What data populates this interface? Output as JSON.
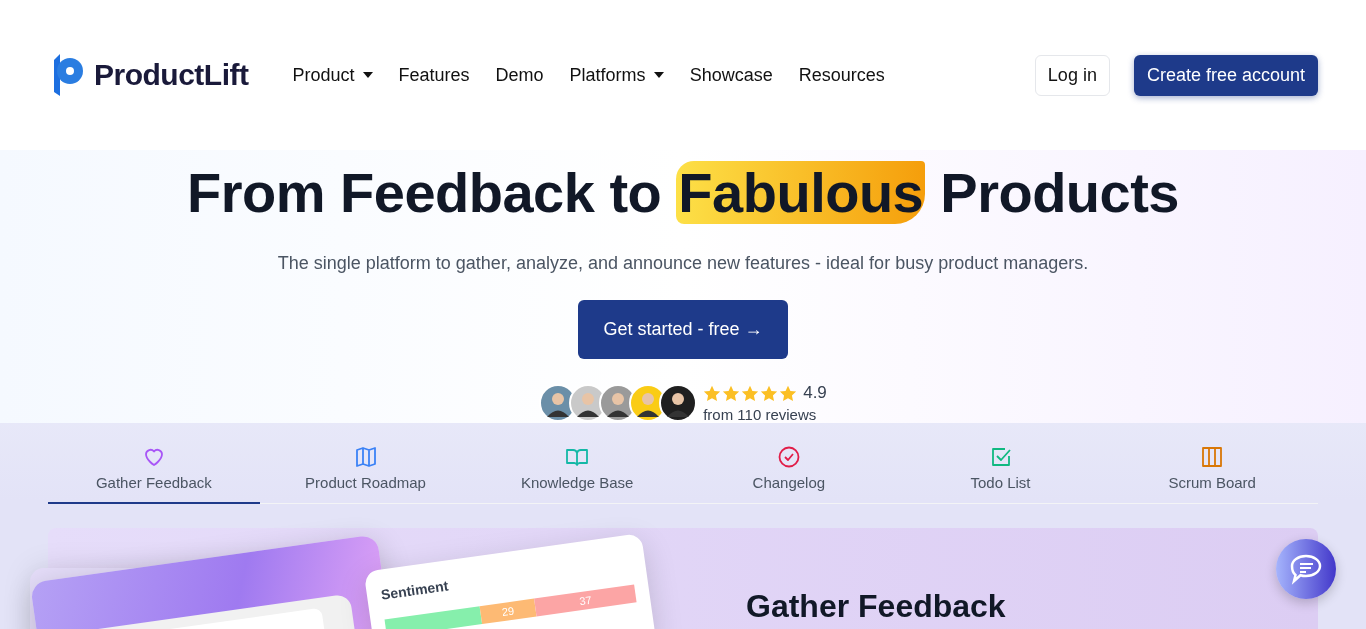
{
  "brand": {
    "name": "ProductLift"
  },
  "nav": [
    {
      "label": "Product",
      "dropdown": true
    },
    {
      "label": "Features",
      "dropdown": false
    },
    {
      "label": "Demo",
      "dropdown": false
    },
    {
      "label": "Platforms",
      "dropdown": true
    },
    {
      "label": "Showcase",
      "dropdown": false
    },
    {
      "label": "Resources",
      "dropdown": false
    }
  ],
  "login": "Log in",
  "signup": "Create free account",
  "hero": {
    "before": "From Feedback to ",
    "highlight": "Fabulous",
    "after": " Products",
    "subtitle": "The single platform to gather, analyze, and announce new features - ideal for busy product managers.",
    "cta": "Get started - free →"
  },
  "reviews": {
    "stars": 5,
    "score": "4.9",
    "count": "from 110 reviews"
  },
  "tabs": [
    {
      "label": "Gather Feedback",
      "selected": true
    },
    {
      "label": "Product Roadmap",
      "selected": false
    },
    {
      "label": "Knowledge Base",
      "selected": false
    },
    {
      "label": "Changelog",
      "selected": false
    },
    {
      "label": "Todo List",
      "selected": false
    },
    {
      "label": "Scrum Board",
      "selected": false
    }
  ],
  "panel": {
    "title": "Gather Feedback",
    "sentiment": {
      "title": "Sentiment",
      "segments": [
        {
          "color": "#86efac"
        },
        {
          "label": "29",
          "color": "#fdba74"
        },
        {
          "label": "37",
          "color": "#fca5a5"
        }
      ]
    }
  }
}
